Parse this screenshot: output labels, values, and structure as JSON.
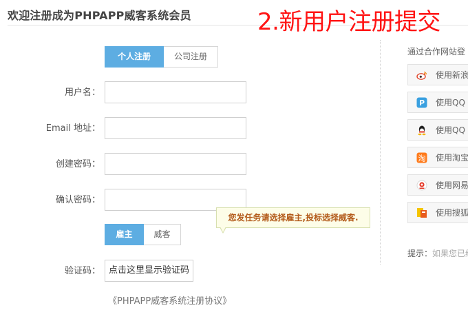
{
  "page": {
    "title": "欢迎注册成为PHPAPP威客系统会员",
    "overlay_caption": "2.新用户注册提交"
  },
  "account_type_tabs": [
    {
      "label": "个人注册",
      "active": true
    },
    {
      "label": "公司注册",
      "active": false
    }
  ],
  "form": {
    "username_label": "用户名：",
    "email_label": "Email 地址：",
    "password_label": "创建密码：",
    "confirm_label": "确认密码：",
    "username_value": "",
    "email_value": "",
    "password_value": "",
    "confirm_value": ""
  },
  "role_tabs": [
    {
      "label": "雇主",
      "active": true
    },
    {
      "label": "威客",
      "active": false
    }
  ],
  "tooltip": {
    "text": "您发任务请选择雇主,投标选择威客."
  },
  "captcha": {
    "label": "验证码：",
    "button_label": "点击这里显示验证码"
  },
  "agreement": {
    "link_text": "《PHPAPP威客系统注册协议》"
  },
  "partner_login": {
    "heading": "通过合作网站登",
    "buttons": [
      {
        "label": "使用新浪",
        "icon": "weibo-icon"
      },
      {
        "label": "使用QQ",
        "icon": "pp-icon"
      },
      {
        "label": "使用QQ",
        "icon": "qq-icon"
      },
      {
        "label": "使用淘宝",
        "icon": "taobao-icon"
      },
      {
        "label": "使用网易",
        "icon": "netease-icon"
      },
      {
        "label": "使用搜狐",
        "icon": "sohu-icon"
      }
    ],
    "hint_label": "提示：",
    "hint_text": "如果您已经"
  },
  "colors": {
    "accent": "#5dade2",
    "caption_red": "#ff1414",
    "tooltip_text": "#b35a1a"
  }
}
